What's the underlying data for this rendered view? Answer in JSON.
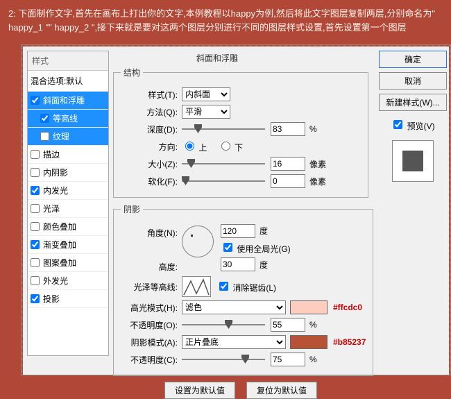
{
  "instructions": "2: 下面制作文字,首先在画布上打出你的文字,本例教程以happy为例,然后将此文字图层复制两层,分别命名为\" happy_1 \"\" happy_2 \",接下来就是要对这两个图层分别进行不同的图层样式设置,首先设置第一个图层",
  "styles": {
    "header": "样式",
    "blend_label": "混合选项:默认",
    "items": [
      {
        "label": "斜面和浮雕",
        "checked": true,
        "selected": true,
        "child": false
      },
      {
        "label": "等高线",
        "checked": true,
        "selected": true,
        "child": true
      },
      {
        "label": "纹理",
        "checked": false,
        "selected": true,
        "child": true
      },
      {
        "label": "描边",
        "checked": false,
        "selected": false,
        "child": false
      },
      {
        "label": "内阴影",
        "checked": false,
        "selected": false,
        "child": false
      },
      {
        "label": "内发光",
        "checked": true,
        "selected": false,
        "child": false
      },
      {
        "label": "光泽",
        "checked": false,
        "selected": false,
        "child": false
      },
      {
        "label": "颜色叠加",
        "checked": false,
        "selected": false,
        "child": false
      },
      {
        "label": "渐变叠加",
        "checked": true,
        "selected": false,
        "child": false
      },
      {
        "label": "图案叠加",
        "checked": false,
        "selected": false,
        "child": false
      },
      {
        "label": "外发光",
        "checked": false,
        "selected": false,
        "child": false
      },
      {
        "label": "投影",
        "checked": true,
        "selected": false,
        "child": false
      }
    ]
  },
  "bevel": {
    "title": "斜面和浮雕",
    "struct": {
      "legend": "结构",
      "style_label": "样式(T):",
      "style_value": "内斜面",
      "technique_label": "方法(Q):",
      "technique_value": "平滑",
      "depth_label": "深度(D):",
      "depth_value": "83",
      "depth_unit": "%",
      "direction_label": "方向:",
      "up": "上",
      "down": "下",
      "size_label": "大小(Z):",
      "size_value": "16",
      "size_unit": "像素",
      "soften_label": "软化(F):",
      "soften_value": "0",
      "soften_unit": "像素"
    },
    "shading": {
      "legend": "阴影",
      "angle_label": "角度(N):",
      "angle_value": "120",
      "angle_unit": "度",
      "global_label": "使用全局光(G)",
      "altitude_label": "高度:",
      "altitude_value": "30",
      "altitude_unit": "度",
      "gloss_label": "光泽等高线:",
      "antialias_label": "消除锯齿(L)",
      "highlight_mode_label": "高光模式(H):",
      "highlight_mode_value": "滤色",
      "highlight_hex": "#ffcdc0",
      "highlight_opacity_label": "不透明度(O):",
      "highlight_opacity_value": "55",
      "highlight_opacity_unit": "%",
      "shadow_mode_label": "阴影模式(A):",
      "shadow_mode_value": "正片叠底",
      "shadow_hex": "#b85237",
      "shadow_opacity_label": "不透明度(C):",
      "shadow_opacity_value": "75",
      "shadow_opacity_unit": "%"
    },
    "buttons": {
      "make_default": "设置为默认值",
      "reset_default": "复位为默认值"
    }
  },
  "side": {
    "ok": "确定",
    "cancel": "取消",
    "new_style": "新建样式(W)...",
    "preview": "预览(V)"
  }
}
